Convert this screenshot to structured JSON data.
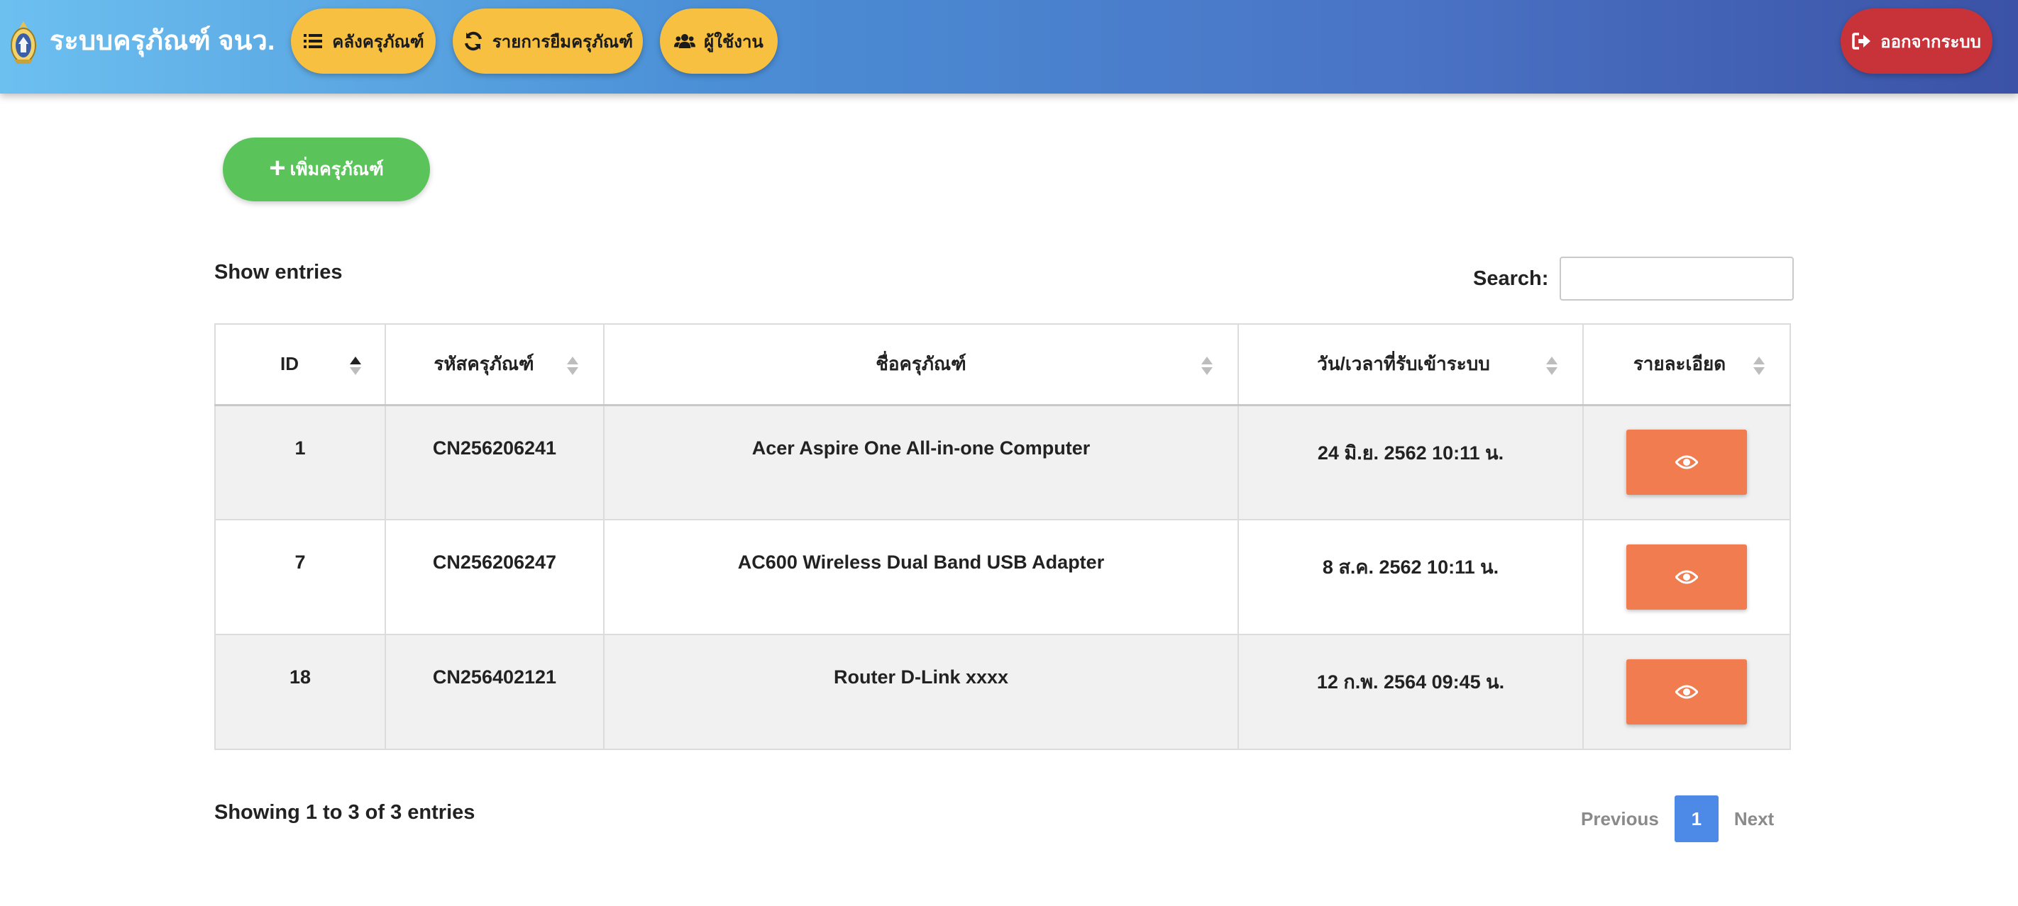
{
  "navbar": {
    "title": "ระบบครุภัณฑ์ จนว.",
    "logo_icon": "school-emblem-icon",
    "items": [
      {
        "label": "คลังครุภัณฑ์",
        "icon": "list-icon"
      },
      {
        "label": "รายการยืมครุภัณฑ์",
        "icon": "sync-icon"
      },
      {
        "label": "ผู้ใช้งาน",
        "icon": "users-icon"
      }
    ],
    "logout_label": "ออกจากระบบ",
    "logout_icon": "sign-out-icon"
  },
  "actions": {
    "add_label": "เพิ่มครุภัณฑ์",
    "add_icon": "plus-icon"
  },
  "table_controls": {
    "show_entries": "Show entries",
    "search_label": "Search:",
    "search_value": ""
  },
  "table": {
    "columns": [
      "ID",
      "รหัสครุภัณฑ์",
      "ชื่อครุภัณฑ์",
      "วัน/เวลาที่รับเข้าระบบ",
      "รายละเอียด"
    ],
    "sorted_column": "ID",
    "sort_direction": "asc",
    "rows": [
      {
        "id": "1",
        "code": "CN256206241",
        "name": "Acer Aspire One All-in-one Computer",
        "received": "24 มิ.ย. 2562 10:11 น.",
        "action_icon": "eye-icon"
      },
      {
        "id": "7",
        "code": "CN256206247",
        "name": "AC600 Wireless Dual Band USB Adapter",
        "received": "8 ส.ค. 2562 10:11 น.",
        "action_icon": "eye-icon"
      },
      {
        "id": "18",
        "code": "CN256402121",
        "name": "Router D-Link xxxx",
        "received": "12 ก.พ. 2564 09:45 น.",
        "action_icon": "eye-icon"
      }
    ]
  },
  "footer": {
    "info": "Showing 1 to 3 of 3 entries",
    "previous_label": "Previous",
    "current_page": "1",
    "next_label": "Next"
  },
  "colors": {
    "nav_gradient_start": "#6cc0f0",
    "nav_gradient_end": "#3b52a6",
    "nav_button": "#f7c041",
    "logout_button": "#c8333a",
    "add_button": "#5ac35a",
    "view_button": "#f07c4f",
    "page_active": "#4d8ae8"
  }
}
